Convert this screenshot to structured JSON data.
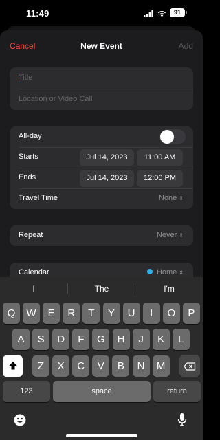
{
  "status": {
    "time": "11:49",
    "battery": "91"
  },
  "nav": {
    "cancel": "Cancel",
    "title": "New Event",
    "add": "Add"
  },
  "title_field": {
    "placeholder": "Title"
  },
  "location_field": {
    "placeholder": "Location or Video Call"
  },
  "allday": {
    "label": "All-day",
    "enabled": false
  },
  "starts": {
    "label": "Starts",
    "date": "Jul 14, 2023",
    "time": "11:00 AM"
  },
  "ends": {
    "label": "Ends",
    "date": "Jul 14, 2023",
    "time": "12:00 PM"
  },
  "travel": {
    "label": "Travel Time",
    "value": "None"
  },
  "repeat": {
    "label": "Repeat",
    "value": "Never"
  },
  "calendar": {
    "label": "Calendar",
    "value": "Home",
    "color": "#32ade6"
  },
  "accent_color": "#ff453a",
  "keyboard": {
    "suggestions": [
      "I",
      "The",
      "I'm"
    ],
    "row1": [
      "Q",
      "W",
      "E",
      "R",
      "T",
      "Y",
      "U",
      "I",
      "O",
      "P"
    ],
    "row2": [
      "A",
      "S",
      "D",
      "F",
      "G",
      "H",
      "J",
      "K",
      "L"
    ],
    "row3": [
      "Z",
      "X",
      "C",
      "V",
      "B",
      "N",
      "M"
    ],
    "numbers_label": "123",
    "space_label": "space",
    "return_label": "return"
  }
}
